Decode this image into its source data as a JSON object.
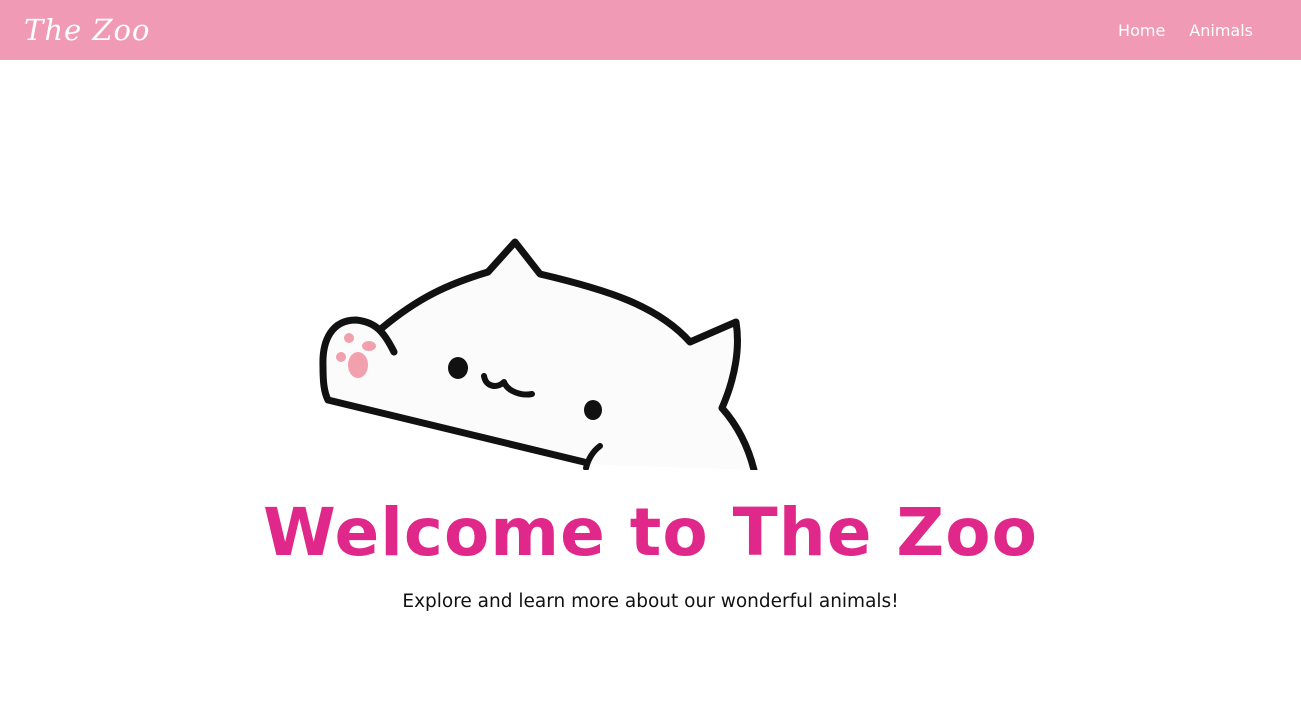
{
  "navbar": {
    "brand": "The Zoo",
    "links": [
      {
        "label": "Home"
      },
      {
        "label": "Animals"
      }
    ]
  },
  "hero": {
    "title": "Welcome to The Zoo",
    "subtitle": "Explore and learn more about our wonderful animals!",
    "image_icon": "waving-cat-illustration"
  },
  "colors": {
    "navbar_bg": "#f09ab6",
    "title": "#e0288a",
    "paw": "#f2a0ae"
  }
}
